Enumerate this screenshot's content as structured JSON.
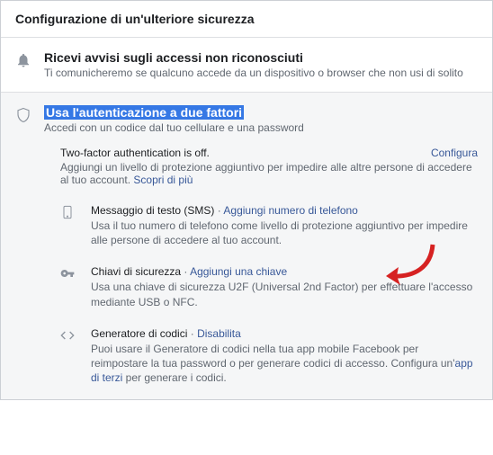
{
  "header": {
    "title": "Configurazione di un'ulteriore sicurezza"
  },
  "alerts": {
    "title": "Ricevi avvisi sugli accessi non riconosciuti",
    "sub": "Ti comunicheremo se qualcuno accede da un dispositivo o browser che non usi di solito"
  },
  "twofa": {
    "title": "Usa l'autenticazione a due fattori",
    "sub": "Accedi con un codice dal tuo cellulare e una password",
    "status": "Two-factor authentication is off.",
    "configure": "Configura",
    "status_desc": "Aggiungi un livello di protezione aggiuntivo per impedire alle altre persone di accedere al tuo account.",
    "learn_more": "Scopri di più",
    "methods": {
      "sms": {
        "label": "Messaggio di testo (SMS)",
        "action": "Aggiungi numero di telefono",
        "desc": "Usa il tuo numero di telefono come livello di protezione aggiuntivo per impedire alle persone di accedere al tuo account."
      },
      "security_keys": {
        "label": "Chiavi di sicurezza",
        "action": "Aggiungi una chiave",
        "desc": "Usa una chiave di sicurezza U2F (Universal 2nd Factor) per effettuare l'accesso mediante USB o NFC."
      },
      "code_gen": {
        "label": "Generatore di codici",
        "action": "Disabilita",
        "desc1": "Puoi usare il Generatore di codici nella tua app mobile Facebook per reimpostare la tua password o per generare codici di accesso. Configura un'",
        "third_party": "app di terzi",
        "desc2": " per generare i codici."
      }
    }
  },
  "separator": " · ",
  "arrow_color": "#d62222"
}
